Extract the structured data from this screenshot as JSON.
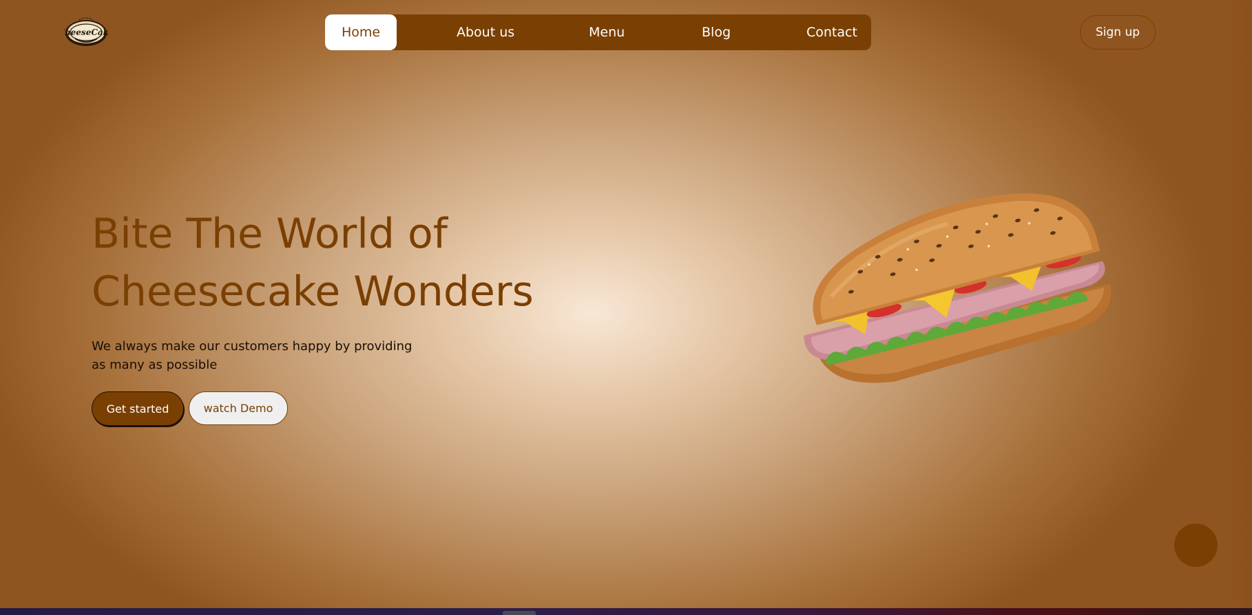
{
  "header": {
    "logo_text": "CheeseCake",
    "logo_icon": "cheesecake-logo",
    "nav": [
      {
        "label": "Home",
        "active": true
      },
      {
        "label": "About us",
        "active": false
      },
      {
        "label": "Menu",
        "active": false
      },
      {
        "label": "Blog",
        "active": false
      },
      {
        "label": "Contact",
        "active": false
      }
    ],
    "signup_label": "Sign up"
  },
  "hero": {
    "title_line1": "Bite The World of",
    "title_line2": "Cheesecake Wonders",
    "subtitle_line1": "We always make our customers happy by providing",
    "subtitle_line2": "as many as possible",
    "primary_button": "Get started",
    "secondary_button": "watch Demo",
    "image": "sandwich-image"
  },
  "floating_button": {
    "icon": "chat-bubble"
  },
  "colors": {
    "brand": "#7a3f02",
    "background_center": "#f8e7d6",
    "background_edge": "#8f5520",
    "text_dark": "#1a0e05",
    "white": "#ffffff"
  }
}
